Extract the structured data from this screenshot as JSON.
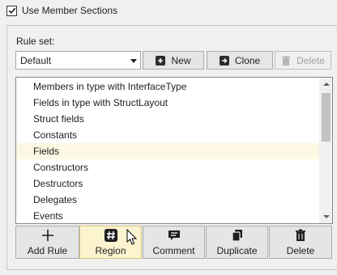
{
  "use_member_sections": {
    "label": "Use Member Sections",
    "checked": true
  },
  "ruleset": {
    "label": "Rule set:",
    "selected": "Default"
  },
  "toolbar": {
    "new_label": "New",
    "clone_label": "Clone",
    "delete_label": "Delete"
  },
  "rules": {
    "items": [
      "Members in type with InterfaceType",
      "Fields in type with StructLayout",
      "Struct fields",
      "Constants",
      "Fields",
      "Constructors",
      "Destructors",
      "Delegates",
      "Events"
    ],
    "selected_index": 4
  },
  "actions": {
    "add_rule": "Add Rule",
    "region": "Region",
    "comment": "Comment",
    "duplicate": "Duplicate",
    "delete": "Delete"
  },
  "colors": {
    "selected_row": "#fcf8e3",
    "active_button": "#fcf3cf"
  },
  "icons": {
    "add": "plus-icon",
    "region": "hash-icon",
    "comment": "comment-icon",
    "duplicate": "duplicate-icon",
    "delete": "trash-icon"
  }
}
